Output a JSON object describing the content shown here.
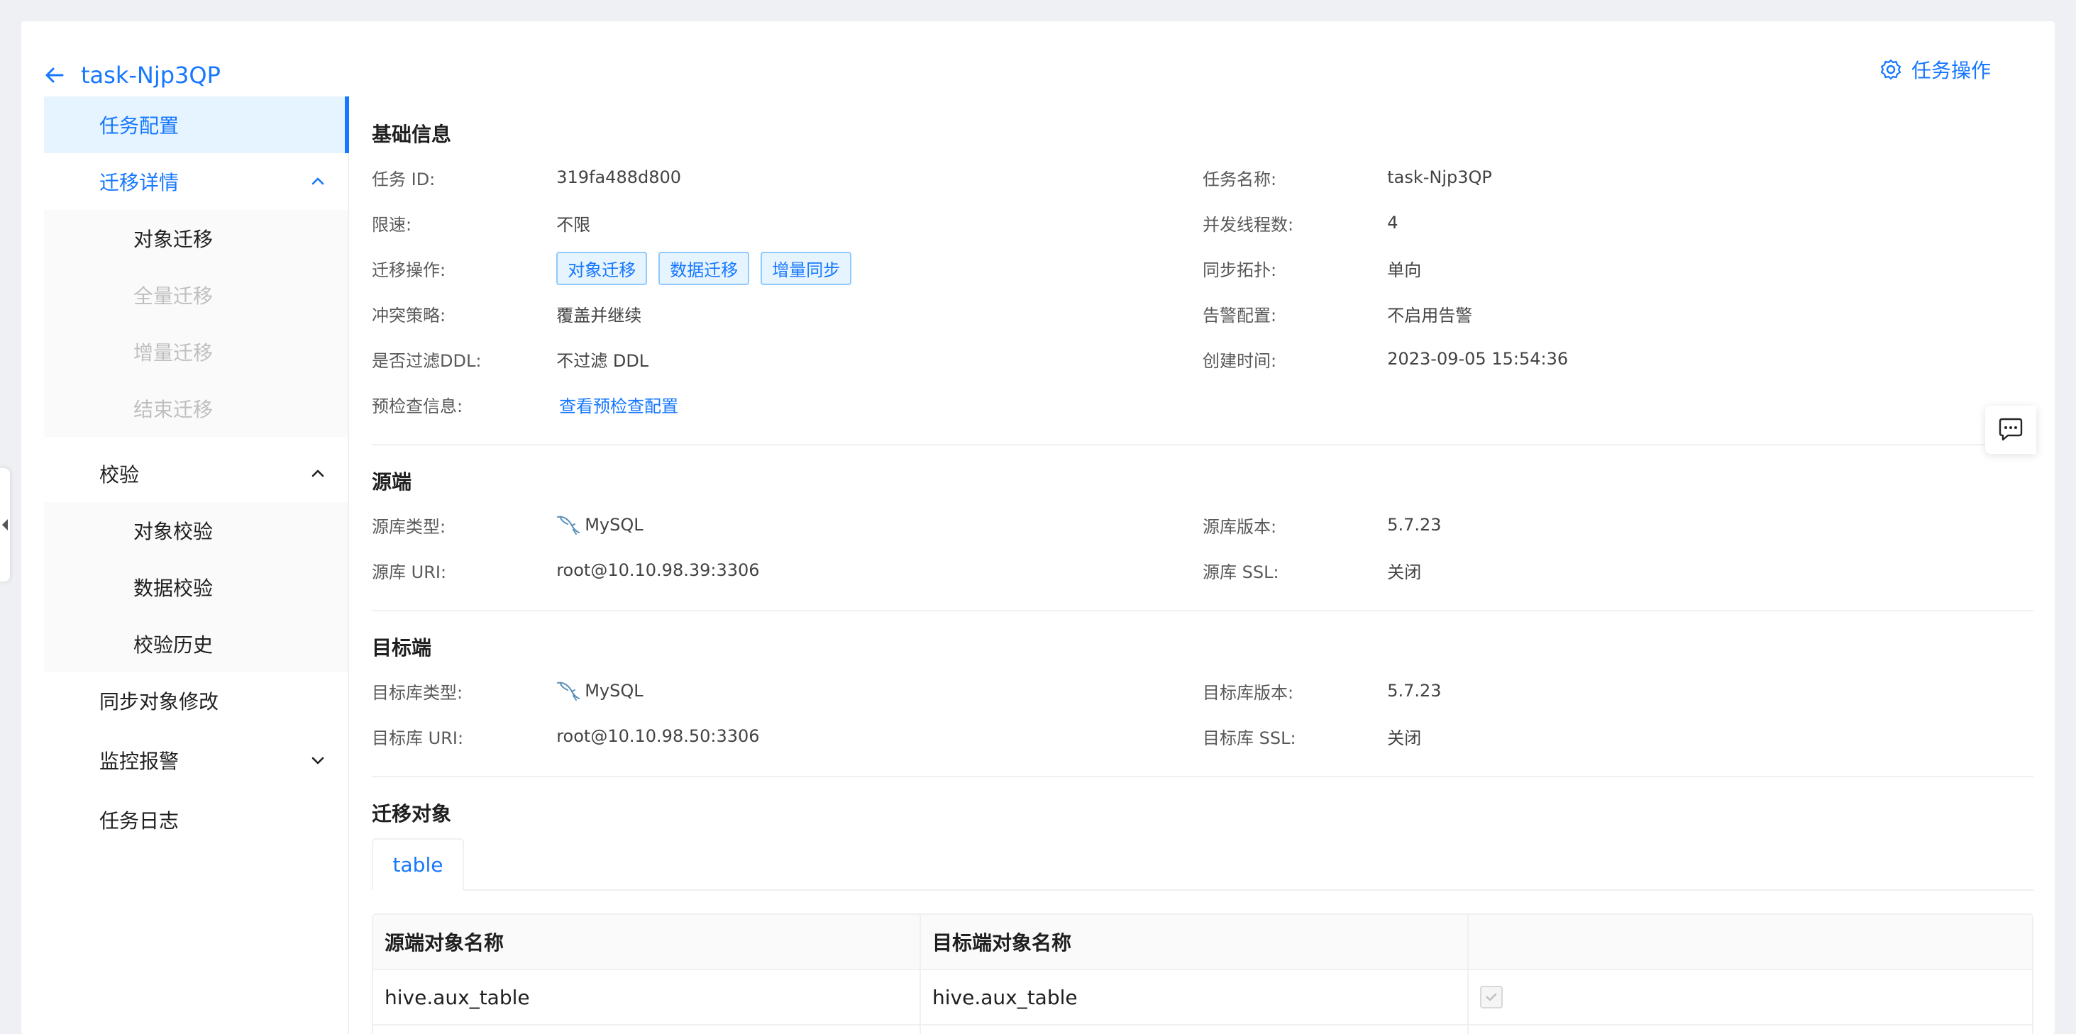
{
  "header": {
    "task_title": "task-Njp3QP",
    "task_op_label": "任务操作"
  },
  "sidebar": {
    "items": [
      {
        "label": "任务配置"
      },
      {
        "label": "迁移详情"
      },
      {
        "label": "校验"
      },
      {
        "label": "同步对象修改"
      },
      {
        "label": "监控报警"
      },
      {
        "label": "任务日志"
      }
    ],
    "migration_sub": [
      {
        "label": "对象迁移"
      },
      {
        "label": "全量迁移"
      },
      {
        "label": "增量迁移"
      },
      {
        "label": "结束迁移"
      }
    ],
    "check_sub": [
      {
        "label": "对象校验"
      },
      {
        "label": "数据校验"
      },
      {
        "label": "校验历史"
      }
    ]
  },
  "basic": {
    "title": "基础信息",
    "task_id_label": "任务 ID:",
    "task_id": "319fa488d800",
    "task_name_label": "任务名称:",
    "task_name": "task-Njp3QP",
    "speed_label": "限速:",
    "speed": "不限",
    "threads_label": "并发线程数:",
    "threads": "4",
    "ops_label": "迁移操作:",
    "ops": [
      "对象迁移",
      "数据迁移",
      "增量同步"
    ],
    "topology_label": "同步拓扑:",
    "topology": "单向",
    "conflict_label": "冲突策略:",
    "conflict": "覆盖并继续",
    "alarm_label": "告警配置:",
    "alarm": "不启用告警",
    "ddl_label": "是否过滤DDL:",
    "ddl": "不过滤 DDL",
    "created_label": "创建时间:",
    "created": "2023-09-05 15:54:36",
    "precheck_label": "预检查信息:",
    "precheck_link": "查看预检查配置"
  },
  "source": {
    "title": "源端",
    "type_label": "源库类型:",
    "type": "MySQL",
    "version_label": "源库版本:",
    "version": "5.7.23",
    "uri_label": "源库 URI:",
    "uri": "root@10.10.98.39:3306",
    "ssl_label": "源库 SSL:",
    "ssl": "关闭"
  },
  "target": {
    "title": "目标端",
    "type_label": "目标库类型:",
    "type": "MySQL",
    "version_label": "目标库版本:",
    "version": "5.7.23",
    "uri_label": "目标库 URI:",
    "uri": "root@10.10.98.50:3306",
    "ssl_label": "目标库 SSL:",
    "ssl": "关闭"
  },
  "objects": {
    "title": "迁移对象",
    "tab_label": "table",
    "columns": [
      "源端对象名称",
      "目标端对象名称",
      ""
    ],
    "rows": [
      {
        "source": "hive.aux_table",
        "target": "hive.aux_table",
        "checked": true
      }
    ]
  },
  "colors": {
    "primary": "#1677ff",
    "tag_bg": "#e6f4ff",
    "tag_border": "#91caff",
    "page_bg": "#eff0f4"
  }
}
